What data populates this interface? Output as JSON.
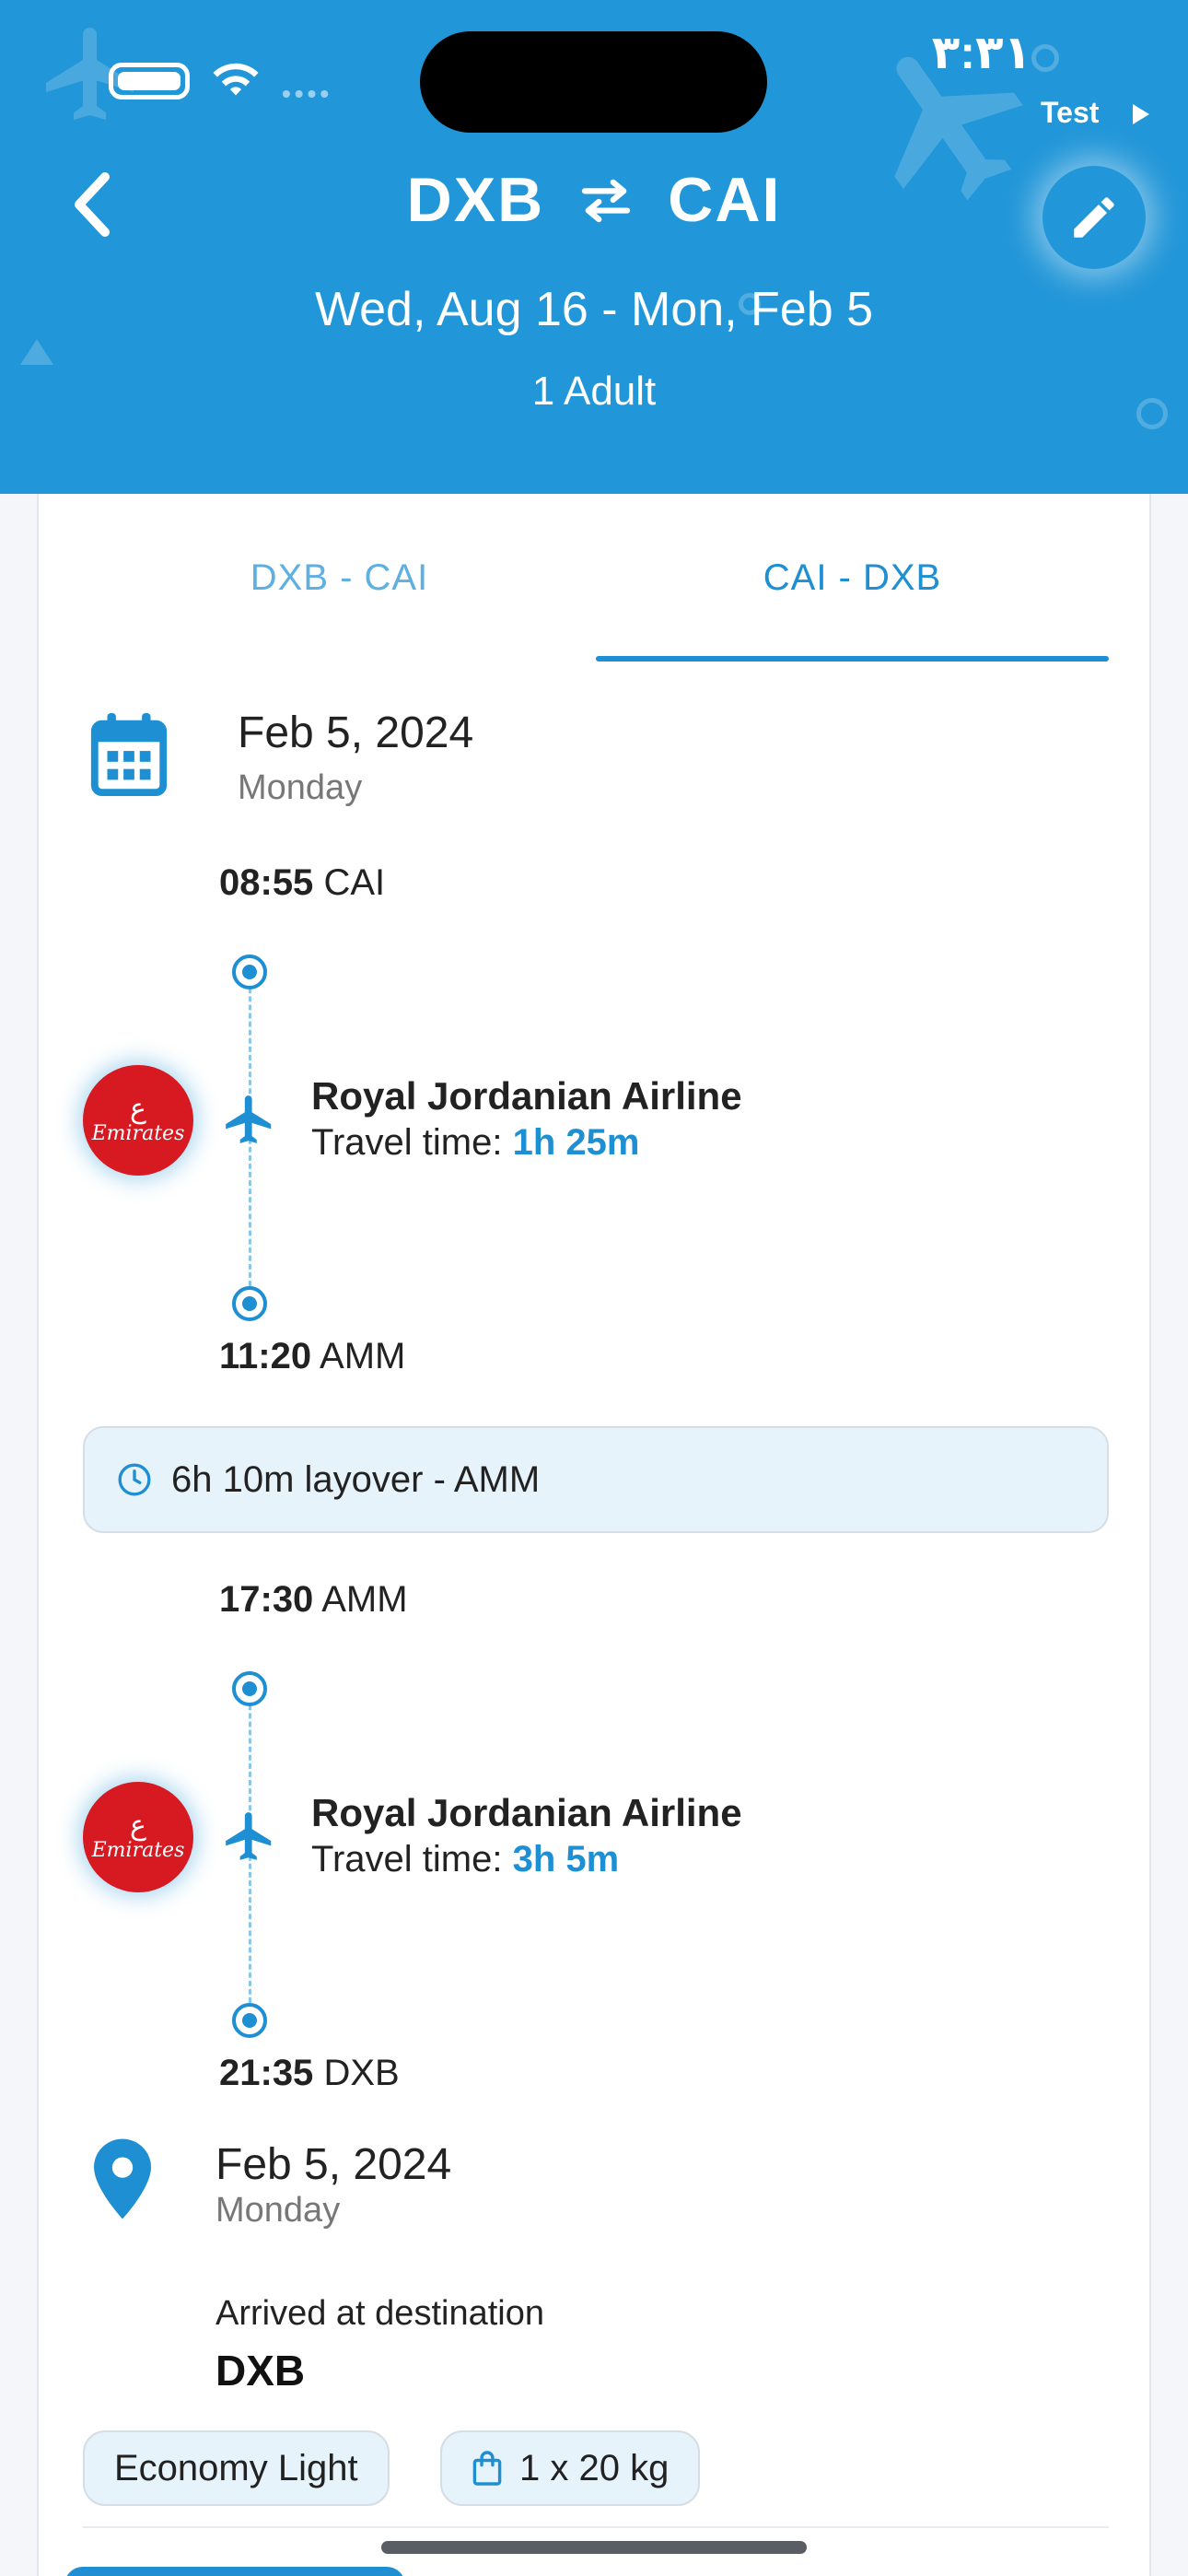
{
  "status_bar": {
    "time": "٣:٣١",
    "test_label": "Test"
  },
  "header": {
    "origin": "DXB",
    "destination": "CAI",
    "dates": "Wed, Aug 16 - Mon, Feb 5",
    "passengers": "1 Adult"
  },
  "tabs": [
    {
      "label": "DXB - CAI",
      "active": false
    },
    {
      "label": "CAI - DXB",
      "active": true
    }
  ],
  "departure_day": {
    "date": "Feb 5, 2024",
    "weekday": "Monday"
  },
  "segments": [
    {
      "depart_time": "08:55",
      "depart_airport": "CAI",
      "airline": "Royal Jordanian Airline",
      "travel_label": "Travel time:",
      "duration": "1h 25m",
      "arrive_time": "11:20",
      "arrive_airport": "AMM",
      "logo_text": "Emirates"
    },
    {
      "depart_time": "17:30",
      "depart_airport": "AMM",
      "airline": "Royal Jordanian Airline",
      "travel_label": "Travel time:",
      "duration": "3h 5m",
      "arrive_time": "21:35",
      "arrive_airport": "DXB",
      "logo_text": "Emirates"
    }
  ],
  "layover": "6h 10m layover - AMM",
  "arrival_day": {
    "date": "Feb 5, 2024",
    "weekday": "Monday"
  },
  "arrival": {
    "label": "Arrived at destination",
    "code": "DXB"
  },
  "chips": {
    "fare_class": "Economy Light",
    "baggage": "1 x 20 kg"
  },
  "colors": {
    "primary": "#2196d8",
    "accent": "#1e8fd2",
    "logo_red": "#d71921"
  }
}
